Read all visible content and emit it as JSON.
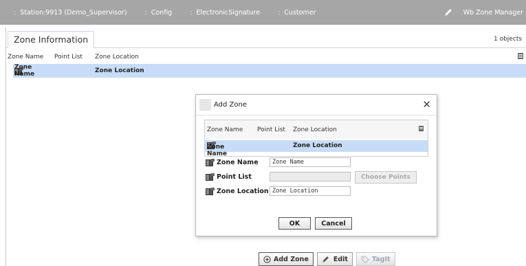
{
  "nav": {
    "crumbs": [
      "Station:9913 (Demo_Supervisor)",
      "Config",
      "ElectronicSignature",
      "Customer"
    ],
    "separator": ":",
    "view_name": "Wb Zone Manager"
  },
  "panel": {
    "tab_label": "Zone Information",
    "object_count": "1 objects",
    "columns": [
      "Zone Name",
      "Point List",
      "Zone Location"
    ],
    "row": {
      "zone_name": "Zone Name",
      "point_list": "",
      "zone_location": "Zone Location"
    }
  },
  "toolbar": {
    "add_zone": "Add Zone",
    "edit": "Edit",
    "tagit": "TagIt"
  },
  "dialog": {
    "title": "Add Zone",
    "close_glyph": "✕",
    "columns": [
      "Zone Name",
      "Point List",
      "Zone Location"
    ],
    "row": {
      "zone_name": "Zone Name",
      "point_list": "",
      "zone_location": "Zone Location"
    },
    "fields": {
      "zone_name_label": "Zone Name",
      "zone_name_value": "Zone Name",
      "point_list_label": "Point List",
      "point_list_value": "",
      "choose_points": "Choose Points",
      "zone_location_label": "Zone Location",
      "zone_location_value": "Zone Location"
    },
    "ok": "OK",
    "cancel": "Cancel"
  },
  "icons": {
    "zone": "zone-table-icon",
    "edit": "pencil-icon",
    "add": "plus-circle-icon",
    "tag": "tag-icon"
  },
  "colors": {
    "navbar": "#a6a6a6",
    "selection": "#c7dcf6"
  }
}
